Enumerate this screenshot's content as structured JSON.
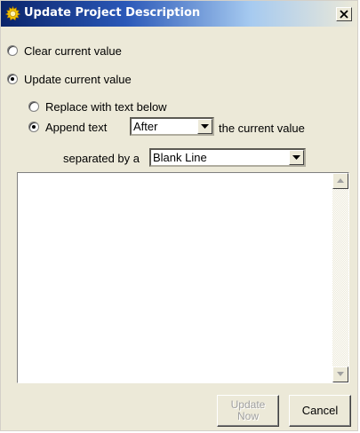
{
  "window": {
    "title": "Update Project Description",
    "title_icon": "sun-gear-icon",
    "close_icon": "close-icon"
  },
  "options": {
    "clear_label": "Clear current value",
    "clear_checked": false,
    "update_label": "Update current value",
    "update_checked": true,
    "replace_label": "Replace with text below",
    "replace_checked": false,
    "append_label": "Append text",
    "append_checked": true
  },
  "position_select": {
    "value": "After",
    "suffix": "the current value"
  },
  "separator": {
    "label": "separated by a",
    "value": "Blank Line"
  },
  "text_area": {
    "value": ""
  },
  "buttons": {
    "update_line1": "Update",
    "update_line2": "Now",
    "update_enabled": false,
    "cancel_label": "Cancel"
  },
  "colors": {
    "titlebar_start": "#0a246a",
    "titlebar_end": "#a6caf0",
    "dialog_bg": "#ece9d8",
    "disabled_text": "#a0a0a0"
  }
}
